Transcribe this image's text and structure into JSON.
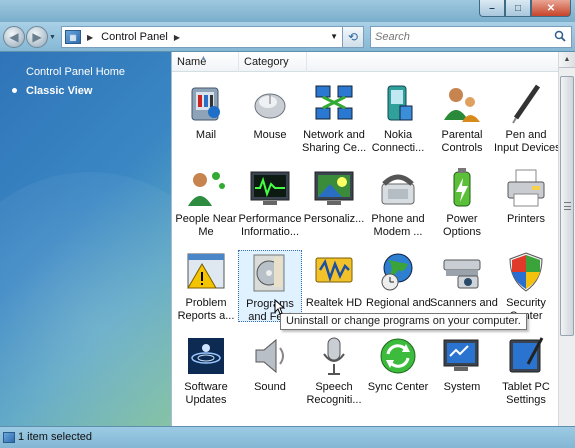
{
  "window": {
    "caption_buttons": {
      "minimize": "–",
      "maximize": "□",
      "close": "✕"
    }
  },
  "nav": {
    "back_glyph": "◀",
    "forward_glyph": "▶",
    "address_path": "Control Panel",
    "search_placeholder": "Search"
  },
  "left_pane": {
    "home_link": "Control Panel Home",
    "classic_view": "Classic View"
  },
  "columns": {
    "name": "Name",
    "category": "Category"
  },
  "items": [
    {
      "label_1": "Mail",
      "label_2": "",
      "icon": "mail-icon"
    },
    {
      "label_1": "Mouse",
      "label_2": "",
      "icon": "mouse-icon"
    },
    {
      "label_1": "Network and",
      "label_2": "Sharing Ce...",
      "icon": "network-icon"
    },
    {
      "label_1": "Nokia",
      "label_2": "Connecti...",
      "icon": "nokia-icon"
    },
    {
      "label_1": "Parental",
      "label_2": "Controls",
      "icon": "parental-controls-icon"
    },
    {
      "label_1": "Pen and",
      "label_2": "Input Devices",
      "icon": "pen-icon"
    },
    {
      "label_1": "People Near",
      "label_2": "Me",
      "icon": "people-near-me-icon"
    },
    {
      "label_1": "Performance",
      "label_2": "Informatio...",
      "icon": "performance-icon"
    },
    {
      "label_1": "Personaliz...",
      "label_2": "",
      "icon": "personalization-icon"
    },
    {
      "label_1": "Phone and",
      "label_2": "Modem ...",
      "icon": "phone-icon"
    },
    {
      "label_1": "Power",
      "label_2": "Options",
      "icon": "power-icon"
    },
    {
      "label_1": "Printers",
      "label_2": "",
      "icon": "printer-icon"
    },
    {
      "label_1": "Problem",
      "label_2": "Reports a...",
      "icon": "problem-reports-icon"
    },
    {
      "label_1": "Programs",
      "label_2": "and Feat",
      "icon": "programs-icon"
    },
    {
      "label_1": "Realtek HD",
      "label_2": "",
      "icon": "realtek-icon"
    },
    {
      "label_1": "Regional and",
      "label_2": "",
      "icon": "regional-icon"
    },
    {
      "label_1": "Scanners and",
      "label_2": "",
      "icon": "scanner-icon"
    },
    {
      "label_1": "Security",
      "label_2": "Center",
      "icon": "security-icon"
    },
    {
      "label_1": "Software",
      "label_2": "Updates",
      "icon": "software-updates-icon"
    },
    {
      "label_1": "Sound",
      "label_2": "",
      "icon": "sound-icon"
    },
    {
      "label_1": "Speech",
      "label_2": "Recogniti...",
      "icon": "speech-icon"
    },
    {
      "label_1": "Sync Center",
      "label_2": "",
      "icon": "sync-icon"
    },
    {
      "label_1": "System",
      "label_2": "",
      "icon": "system-icon"
    },
    {
      "label_1": "Tablet PC",
      "label_2": "Settings",
      "icon": "tablet-icon"
    }
  ],
  "tooltip": "Uninstall or change programs on your computer.",
  "status": {
    "text": "1 item selected"
  }
}
